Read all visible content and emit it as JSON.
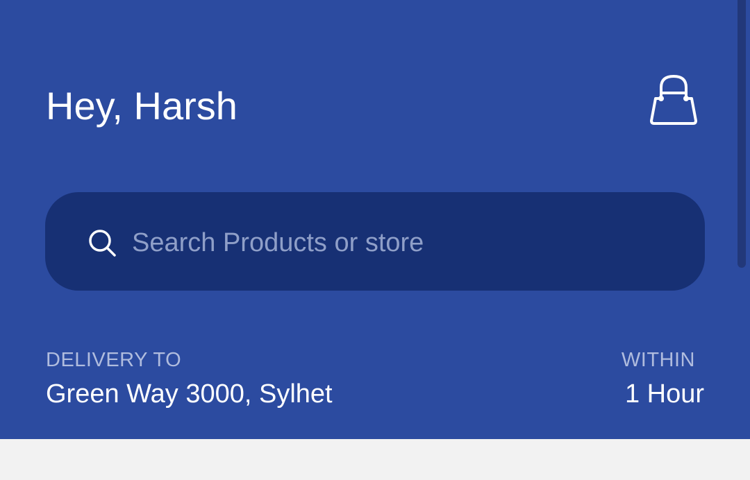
{
  "header": {
    "greeting": "Hey, Harsh",
    "cart_icon": "shopping-bag-icon"
  },
  "search": {
    "placeholder": "Search Products or store",
    "icon": "search-icon"
  },
  "delivery": {
    "label": "DELIVERY TO",
    "address": "Green Way 3000, Sylhet"
  },
  "eta": {
    "label": "WITHIN",
    "value": "1 Hour"
  },
  "colors": {
    "header_bg": "#2c4ba0",
    "search_bg": "#173074",
    "page_bg": "#f2f2f2"
  }
}
